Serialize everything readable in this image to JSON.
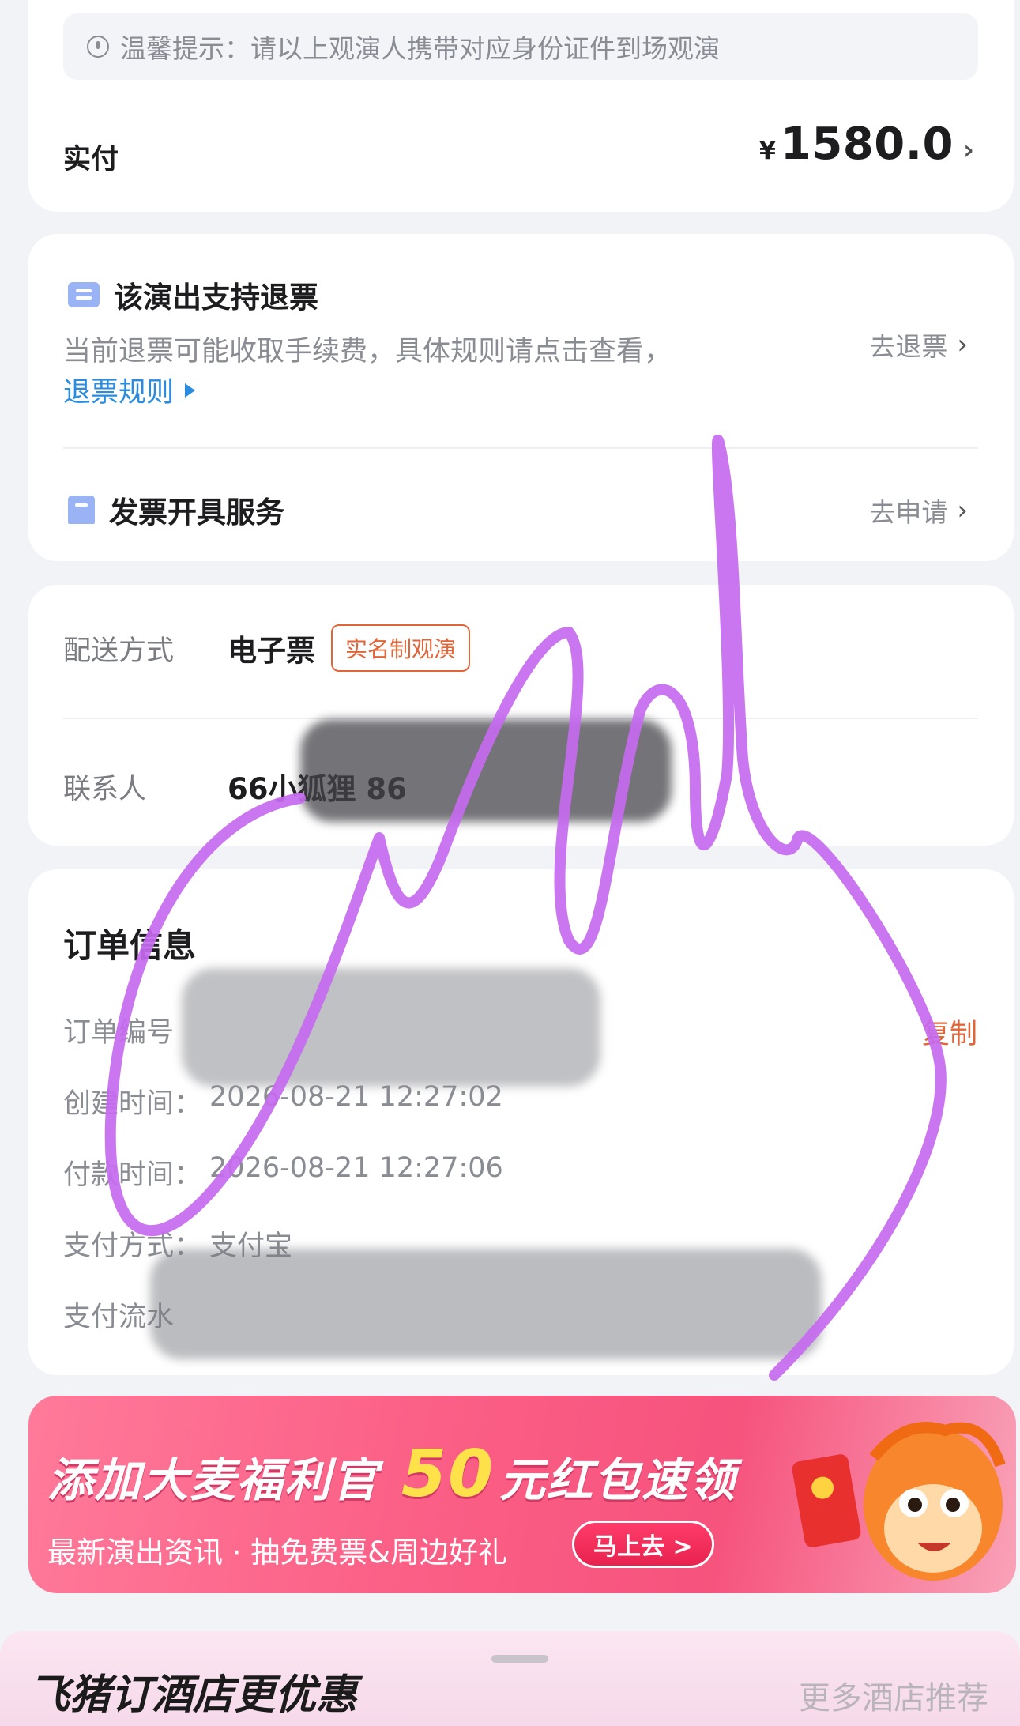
{
  "payment": {
    "tip": "温馨提示：请以上观演人携带对应身份证件到场观演",
    "paid_label": "实付",
    "currency": "¥",
    "paid_amount": "1580.0"
  },
  "refund": {
    "title": "该演出支持退票",
    "description": "当前退票可能收取手续费，具体规则请点击查看，",
    "rules_link": "退票规则",
    "action": "去退票"
  },
  "invoice": {
    "title": "发票开具服务",
    "action": "去申请"
  },
  "delivery": {
    "method_label": "配送方式",
    "method_value": "电子票",
    "badge": "实名制观演",
    "contact_label": "联系人",
    "contact_value": "66小狐狸 86"
  },
  "order": {
    "title": "订单信息",
    "number_label": "订单编号",
    "copy": "复制",
    "created_label": "创建时间：",
    "created_value": "2026-08-21 12:27:02",
    "paid_label": "付款时间：",
    "paid_value": "2026-08-21 12:27:06",
    "method_label": "支付方式：",
    "method_value": "支付宝",
    "serial_label": "支付流水"
  },
  "banner": {
    "title_a": "添加大麦福利官",
    "title_num": "50",
    "title_b": "元红包速领",
    "subtitle": "最新演出资讯 · 抽免费票&周边好礼",
    "button": "马上去 >"
  },
  "bottom_sheet": {
    "title": "飞猪订酒店更优惠",
    "more": "更多酒店推荐"
  },
  "colors": {
    "accent_orange": "#e0663a",
    "link_blue": "#2a8ce0",
    "scribble_purple": "#c56af0"
  }
}
